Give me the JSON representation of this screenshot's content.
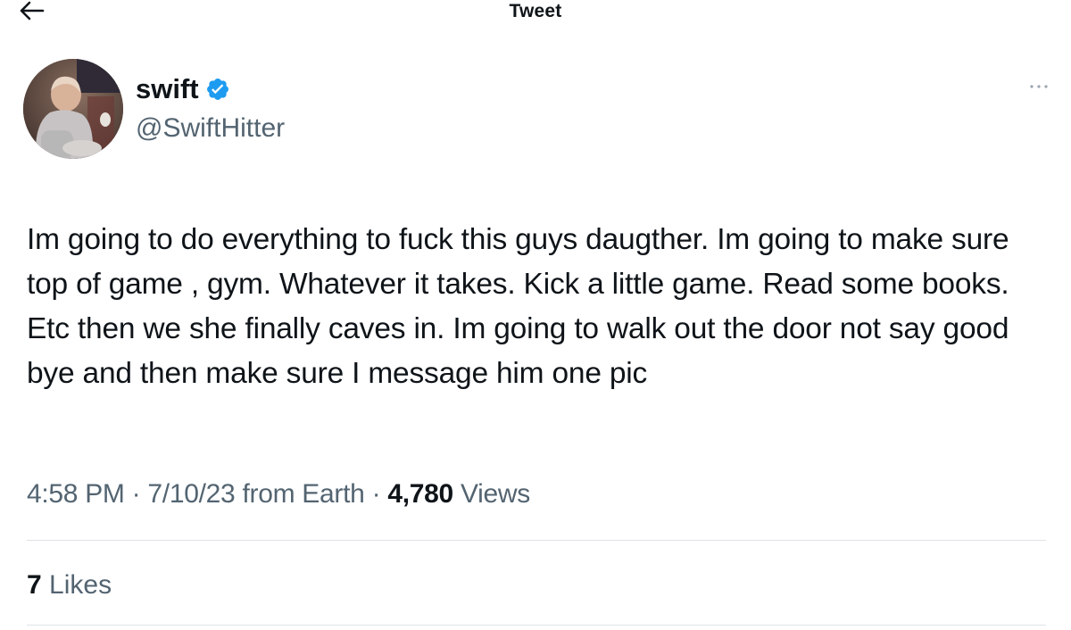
{
  "header": {
    "title": "Tweet",
    "back_icon": "arrow-left-icon"
  },
  "author": {
    "display_name": "swift",
    "handle": "@SwiftHitter",
    "verified_icon": "verified-badge-icon",
    "verified_color": "#1d9bf0",
    "avatar_icon": "user-avatar"
  },
  "more_icon": "more-horizontal-icon",
  "tweet": {
    "text": "Im going to do everything to fuck this guys daugther. Im going to make sure top of game , gym. Whatever it takes. Kick a little game. Read some books. Etc then we she finally caves in. Im going to walk out the door not say good bye and then make sure I message him one pic"
  },
  "meta": {
    "time": "4:58 PM",
    "separator": "·",
    "date": "7/10/23",
    "source": "from Earth",
    "views_count": "4,780",
    "views_label": "Views"
  },
  "engagement": {
    "likes_count": "7",
    "likes_label": "Likes"
  },
  "colors": {
    "text": "#0f1419",
    "secondary": "#536471",
    "divider": "#dfe3e6",
    "accent": "#1d9bf0"
  }
}
